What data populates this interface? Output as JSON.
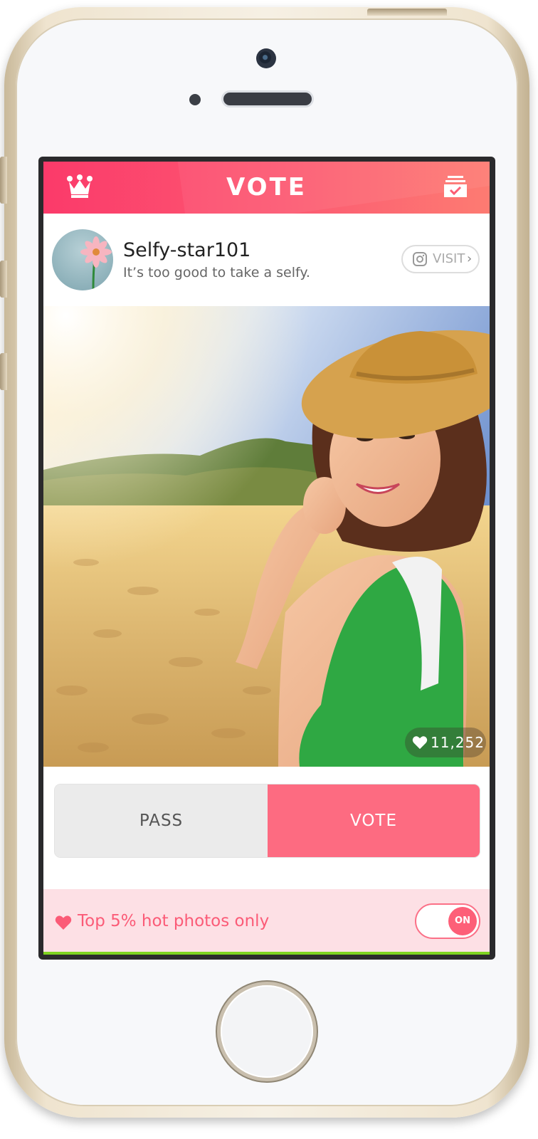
{
  "header": {
    "title": "VOTE",
    "left_icon": "crown-icon",
    "right_icon": "inbox-check-icon"
  },
  "profile": {
    "username": "Selfy-star101",
    "tagline": "It’s too good to take a selfy.",
    "visit_label": "VISIT",
    "visit_chevron": "›",
    "visit_icon": "instagram-icon"
  },
  "photo": {
    "likes": "11,252",
    "likes_icon": "heart-icon"
  },
  "actions": {
    "pass_label": "PASS",
    "vote_label": "VOTE"
  },
  "filter": {
    "label": "Top 5% hot photos only",
    "toggle_label": "ON",
    "toggle_state": "on"
  },
  "colors": {
    "accent": "#fc4c6e",
    "vote_button": "#fd6b81",
    "filter_bg": "#fde0e5",
    "progress": "#7ed321"
  }
}
